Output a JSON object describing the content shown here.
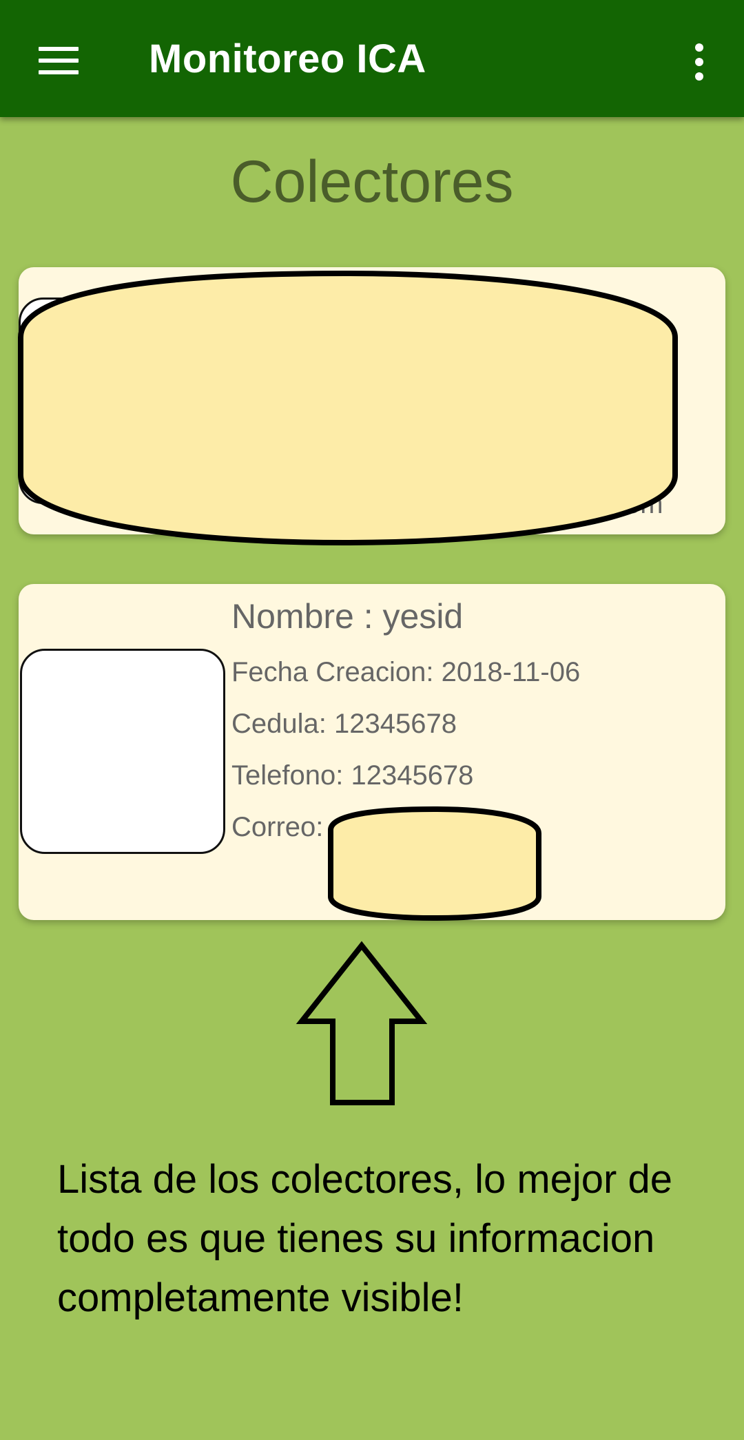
{
  "appbar": {
    "title": "Monitoreo ICA",
    "menu_icon": "hamburger-menu-icon",
    "overflow_icon": "more-vertical-icon",
    "color": "#136503"
  },
  "page": {
    "title": "Colectores",
    "background": "#a0c45a"
  },
  "collectors": [
    {
      "email_visible_tail": "om"
    },
    {
      "name_label": "Nombre : yesid",
      "fecha_label": "Fecha Creacion: 2018-11-06",
      "cedula_label": "Cedula: 12345678",
      "telefono_label": "Telefono: 12345678",
      "correo_label": "Correo:"
    }
  ],
  "annotation": {
    "arrow_icon": "up-arrow-icon",
    "caption": "Lista de los colectores, lo mejor de todo es que tienes su informacion completamente visible!"
  }
}
